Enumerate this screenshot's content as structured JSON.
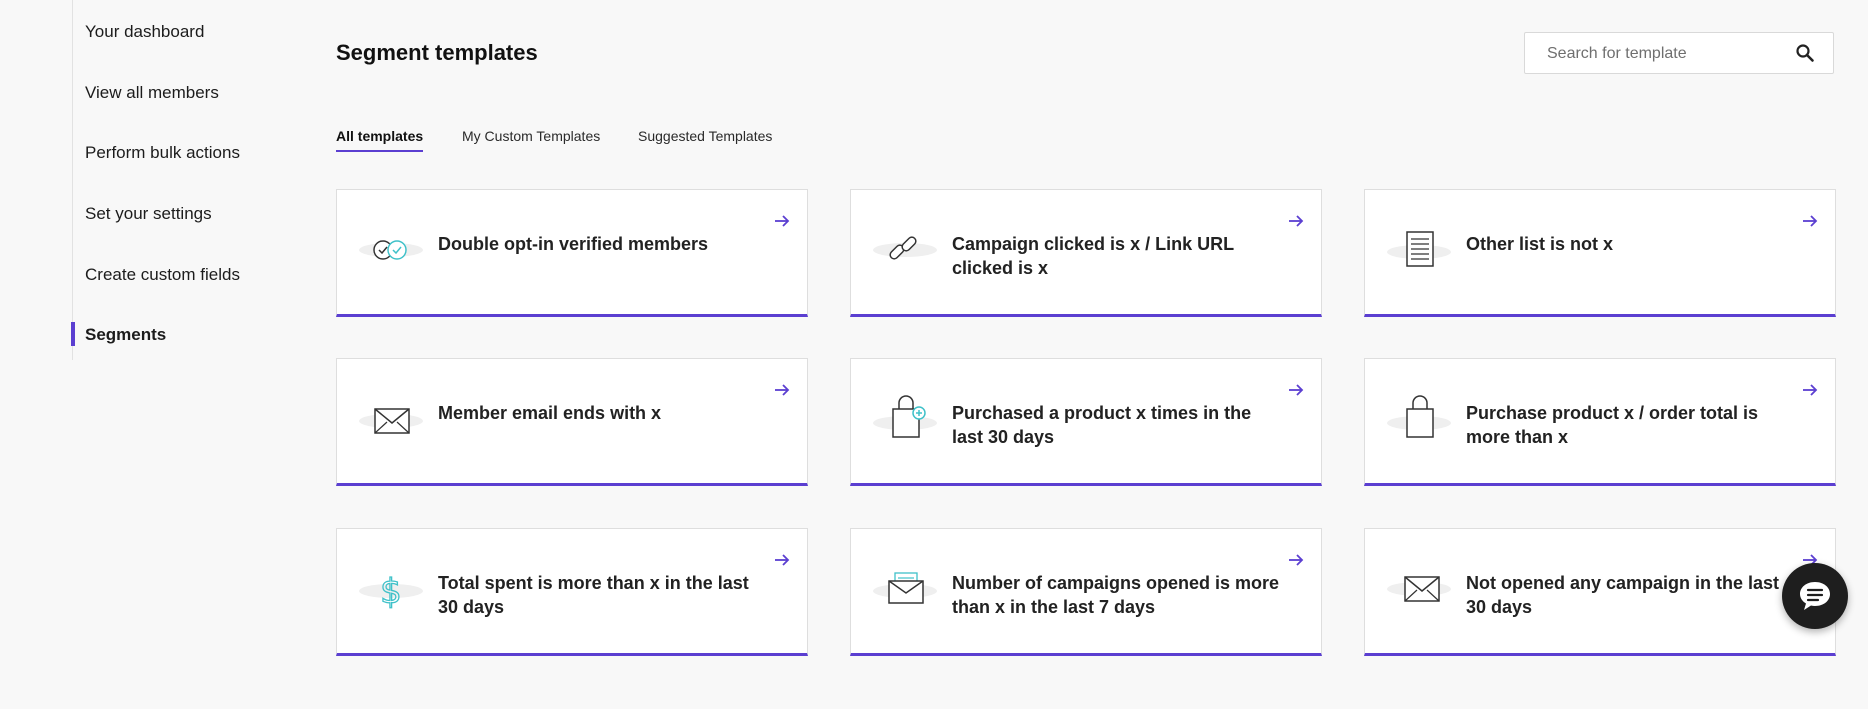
{
  "sidebar": {
    "items": [
      {
        "label": "Your dashboard",
        "active": false
      },
      {
        "label": "View all members",
        "active": false
      },
      {
        "label": "Perform bulk actions",
        "active": false
      },
      {
        "label": "Set your settings",
        "active": false
      },
      {
        "label": "Create custom fields",
        "active": false
      },
      {
        "label": "Segments",
        "active": true
      }
    ]
  },
  "header": {
    "title": "Segment templates",
    "search_placeholder": "Search for template"
  },
  "tabs": [
    {
      "label": "All templates",
      "active": true
    },
    {
      "label": "My Custom Templates",
      "active": false
    },
    {
      "label": "Suggested Templates",
      "active": false
    }
  ],
  "cards": [
    {
      "title": "Double opt-in verified members",
      "icon": "double-check-icon"
    },
    {
      "title": "Campaign clicked is x / Link URL clicked is x",
      "icon": "link-icon"
    },
    {
      "title": "Other list is not x",
      "icon": "list-document-icon"
    },
    {
      "title": "Member email ends with x",
      "icon": "envelope-icon"
    },
    {
      "title": "Purchased a product x times in the last 30 days",
      "icon": "shopping-bag-plus-icon"
    },
    {
      "title": "Purchase product x / order total is more than x",
      "icon": "shopping-bag-icon"
    },
    {
      "title": "Total spent is more than x in the last 30 days",
      "icon": "dollar-icon"
    },
    {
      "title": "Number of campaigns opened is more than x in the last 7 days",
      "icon": "open-envelope-icon"
    },
    {
      "title": "Not opened any campaign in the last 30 days",
      "icon": "envelope-icon"
    }
  ],
  "colors": {
    "accent": "#5b3fd1",
    "icon_teal": "#3fc1c9",
    "background": "#f8f8f8"
  }
}
